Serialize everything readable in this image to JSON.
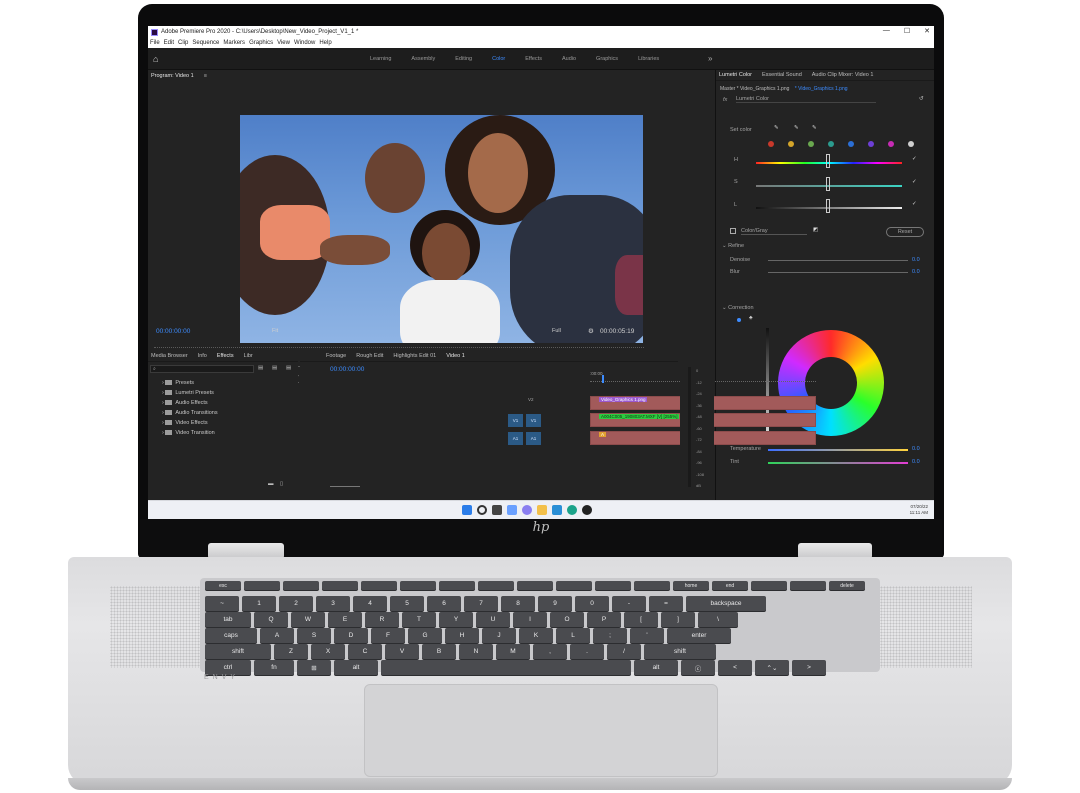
{
  "window": {
    "title": "Adobe Premiere Pro 2020 - C:\\Users\\Desktop\\New_Video_Project_V1_1 *",
    "controls": [
      "—",
      "☐",
      "✕"
    ]
  },
  "menu": [
    "File",
    "Edit",
    "Clip",
    "Sequence",
    "Markers",
    "Graphics",
    "View",
    "Window",
    "Help"
  ],
  "workspaces": {
    "tabs": [
      "Learning",
      "Assembly",
      "Editing",
      "Color",
      "Effects",
      "Audio",
      "Graphics",
      "Libraries"
    ],
    "active": "Color",
    "more": "»"
  },
  "program": {
    "title": "Program: Video 1",
    "timecode_current": "00:00:00:00",
    "timecode_end": "00:00:05:19",
    "fit": "Fit",
    "quality": "Full"
  },
  "lumetri": {
    "tabs": [
      "Lumetri Color",
      "Essential Sound",
      "Audio Clip Mixer: Video 1"
    ],
    "master": "Master * Video_Graphics 1.png",
    "clip": "* Video_Graphics 1.png",
    "fx": "fx",
    "effect_name": "Lumetri Color",
    "set_color": "Set color",
    "swatches": [
      "#c8392b",
      "#d4a52a",
      "#6aa84f",
      "#2b9b8e",
      "#2b6fd6",
      "#6d3fd6",
      "#c62bb4",
      "#cfcfcf"
    ],
    "hsl": [
      "H",
      "S",
      "L"
    ],
    "color_gray": "Color/Gray",
    "reset": "Reset",
    "refine": "Refine",
    "denoise": {
      "label": "Denoise",
      "value": "0.0"
    },
    "blur": {
      "label": "Blur",
      "value": "0.0"
    },
    "correction": "Correction",
    "temperature": {
      "label": "Temperature",
      "value": "0.0"
    },
    "tint": {
      "label": "Tint",
      "value": "0.0"
    }
  },
  "effects_panel": {
    "tabs": [
      "Media Browser",
      "Info",
      "Effects",
      "Libr"
    ],
    "items": [
      "Presets",
      "Lumetri Presets",
      "Audio Effects",
      "Audio Transitions",
      "Video Effects",
      "Video Transition"
    ]
  },
  "timeline": {
    "tabs": [
      "Footage",
      "Rough Edit",
      "Highlights Edit 01",
      "Video 1"
    ],
    "timecode": "00:00:00:00",
    "ruler": ":00:00",
    "tracks": [
      "V2",
      "V1",
      "A1"
    ],
    "clips": [
      "Video_Graphics 1.png",
      "A004C005_190803AT.MXF [V] [255%]",
      "A"
    ]
  },
  "meter_scale": [
    "0",
    "-12",
    "-24",
    "-36",
    "-48",
    "-60",
    "-72",
    "-84",
    "-96",
    "-108",
    "dB"
  ],
  "taskbar": {
    "date": "07/20/22",
    "time": "11:11 AM"
  },
  "keyboard": {
    "brand": "ENVY",
    "row_fn": [
      "esc",
      "",
      "",
      "",
      "",
      "",
      "",
      "",
      "",
      "",
      "",
      "",
      "home",
      "end",
      "",
      "",
      "delete"
    ],
    "row1": [
      "~",
      "1",
      "2",
      "3",
      "4",
      "5",
      "6",
      "7",
      "8",
      "9",
      "0",
      "-",
      "=",
      "backspace"
    ],
    "row2": [
      "tab",
      "Q",
      "W",
      "E",
      "R",
      "T",
      "Y",
      "U",
      "I",
      "O",
      "P",
      "[",
      "]",
      "\\"
    ],
    "row3": [
      "caps",
      "A",
      "S",
      "D",
      "F",
      "G",
      "H",
      "J",
      "K",
      "L",
      ";",
      "'",
      "enter"
    ],
    "row4": [
      "shift",
      "Z",
      "X",
      "C",
      "V",
      "B",
      "N",
      "M",
      ",",
      ".",
      "/",
      "shift"
    ],
    "row5": [
      "ctrl",
      "fn",
      "⊞",
      "alt",
      "",
      "alt",
      "ⓒ",
      "<",
      "⌃⌄",
      ">"
    ]
  },
  "colors": {
    "accent": "#3d8cff",
    "panel": "#232323",
    "clip_red": "#a25a5a",
    "clip_label_purple": "#9b59d0",
    "clip_label_green": "#2ecc40"
  }
}
